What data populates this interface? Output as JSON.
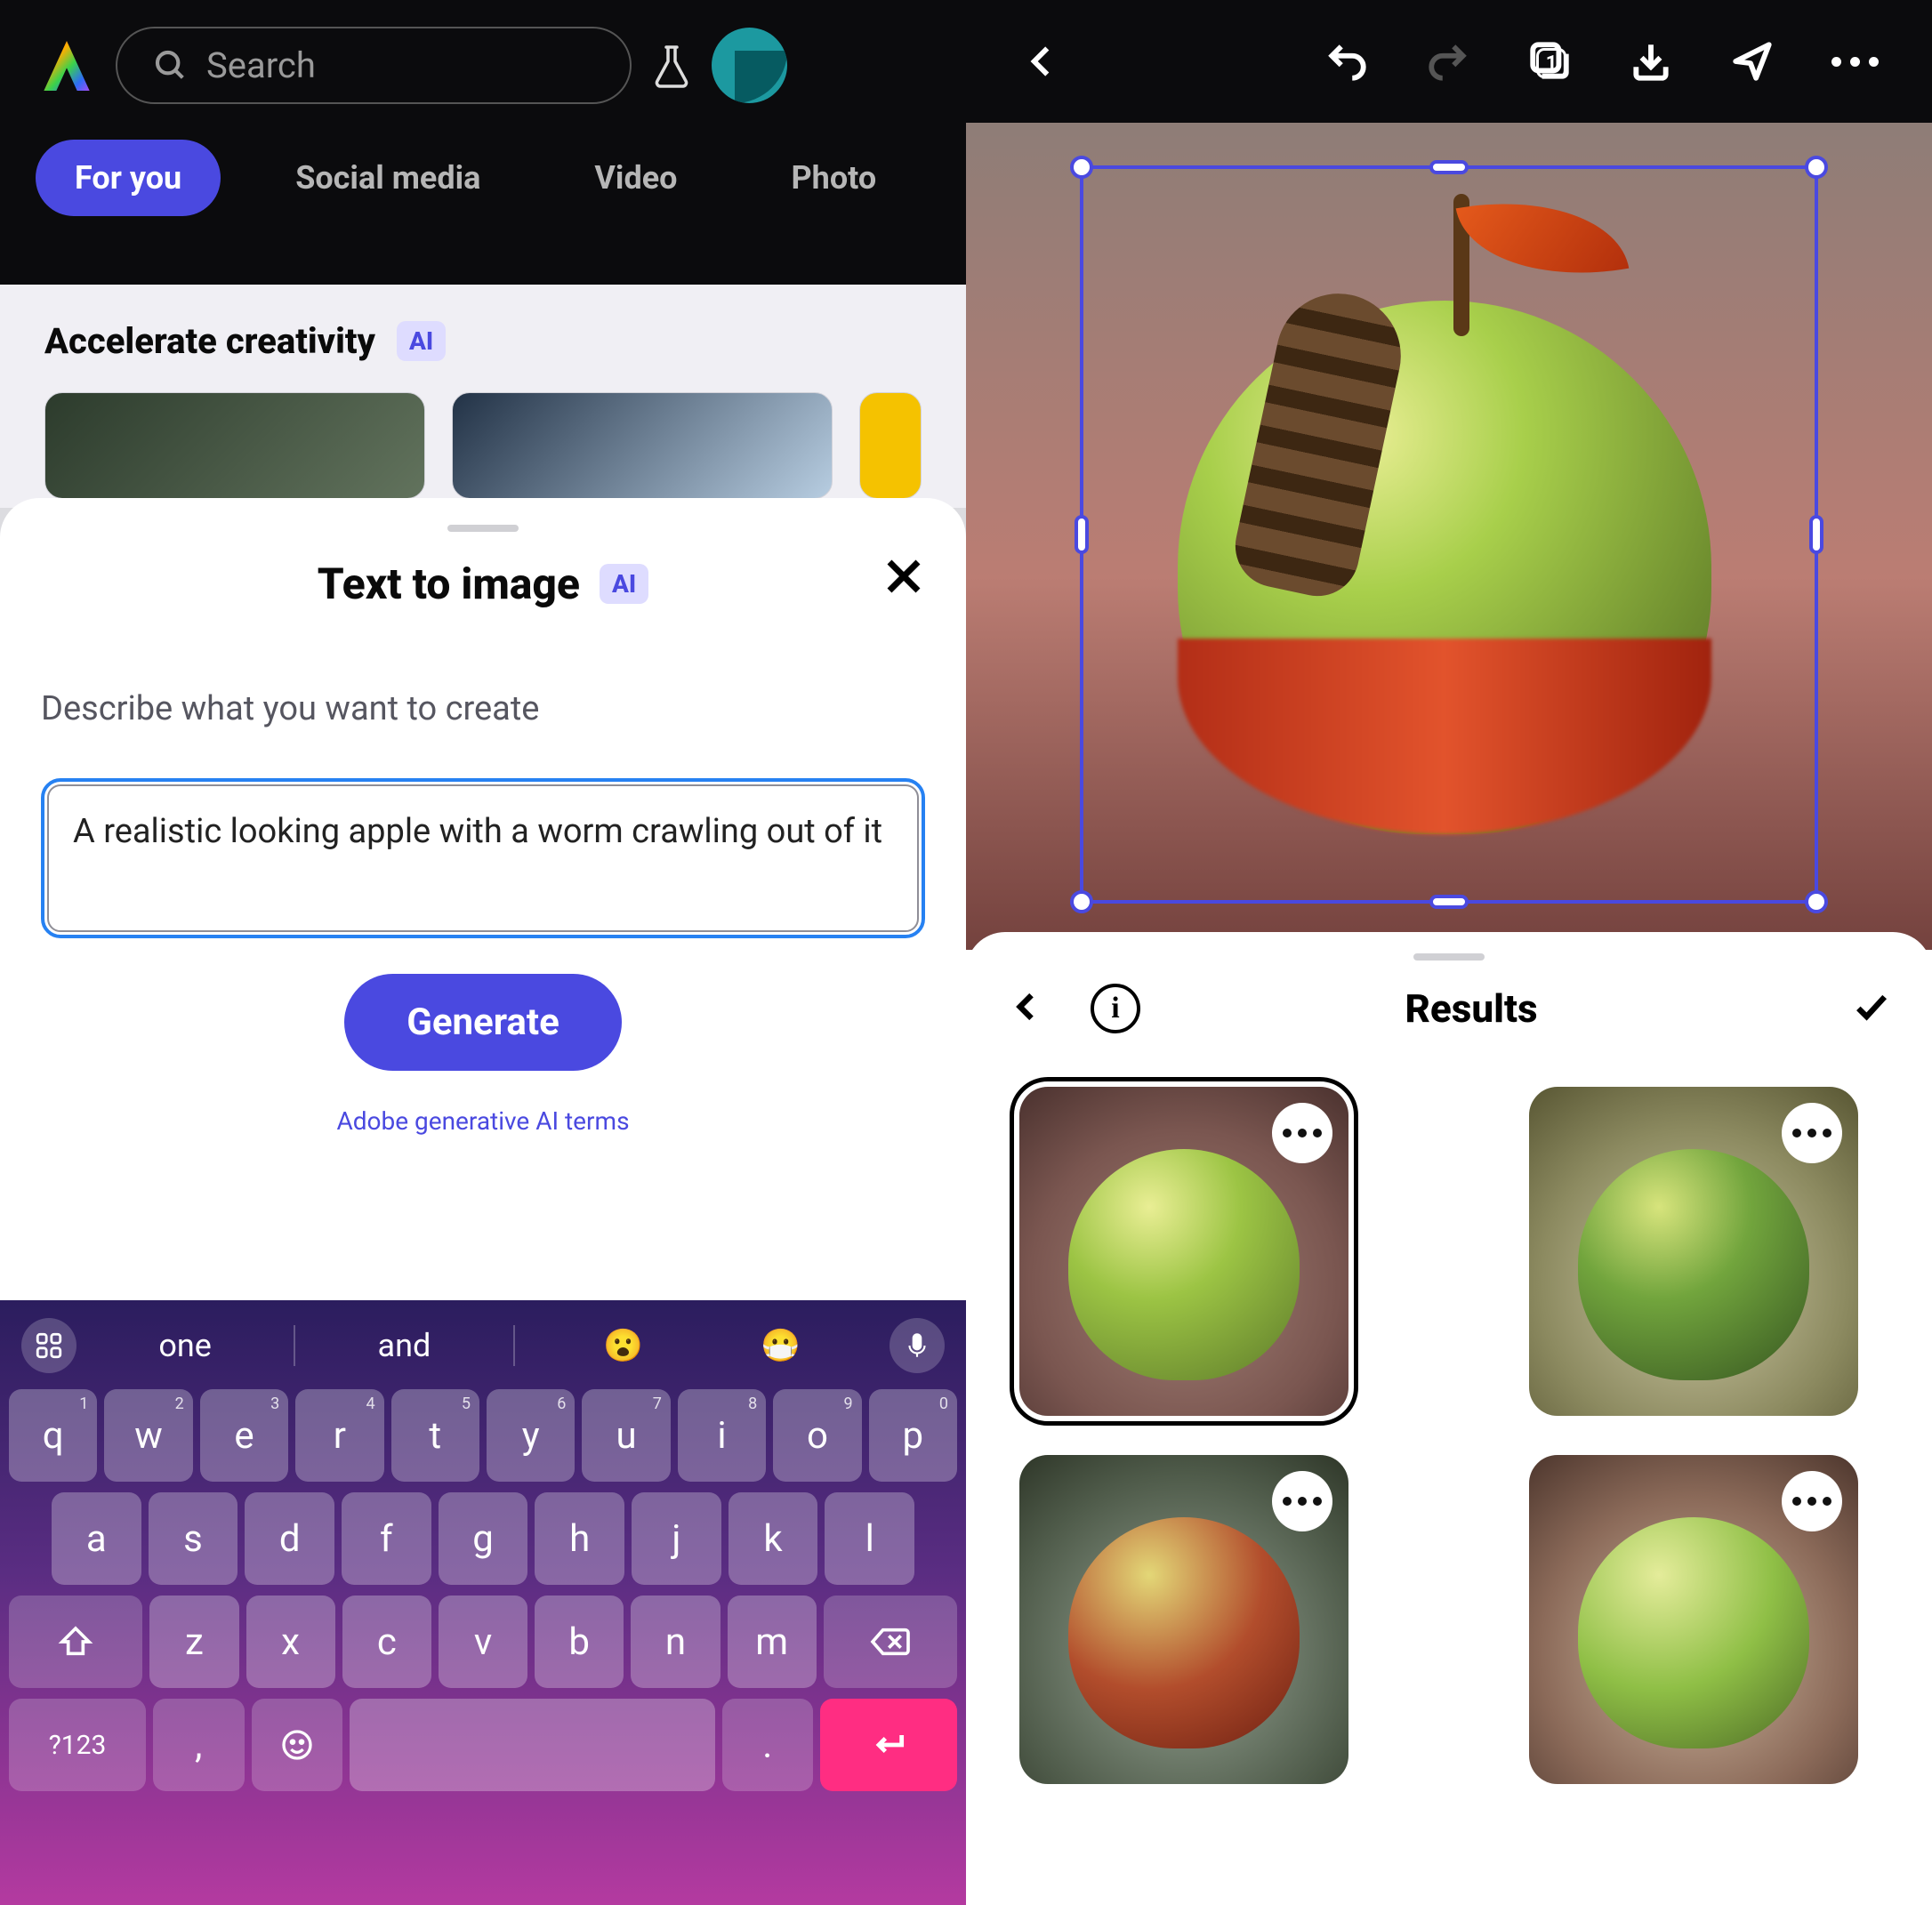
{
  "left": {
    "search_placeholder": "Search",
    "tabs": [
      "For you",
      "Social media",
      "Video",
      "Photo"
    ],
    "accelerate_title": "Accelerate creativity",
    "ai_badge": "AI",
    "sheet": {
      "title": "Text to image",
      "desc": "Describe what you want to create",
      "prompt": "A realistic looking apple with a worm crawling out of it ",
      "generate_label": "Generate",
      "terms_label": "Adobe generative AI terms"
    },
    "keyboard": {
      "suggestions": [
        "one",
        "and"
      ],
      "emoji1": "😮",
      "emoji2": "😷",
      "row1": [
        {
          "k": "q",
          "n": "1"
        },
        {
          "k": "w",
          "n": "2"
        },
        {
          "k": "e",
          "n": "3"
        },
        {
          "k": "r",
          "n": "4"
        },
        {
          "k": "t",
          "n": "5"
        },
        {
          "k": "y",
          "n": "6"
        },
        {
          "k": "u",
          "n": "7"
        },
        {
          "k": "i",
          "n": "8"
        },
        {
          "k": "o",
          "n": "9"
        },
        {
          "k": "p",
          "n": "0"
        }
      ],
      "row2": [
        "a",
        "s",
        "d",
        "f",
        "g",
        "h",
        "j",
        "k",
        "l"
      ],
      "row3": [
        "z",
        "x",
        "c",
        "v",
        "b",
        "n",
        "m"
      ],
      "sym_label": "?123",
      "comma": ",",
      "period": "."
    }
  },
  "right": {
    "layer_count": "1",
    "results_title": "Results"
  }
}
